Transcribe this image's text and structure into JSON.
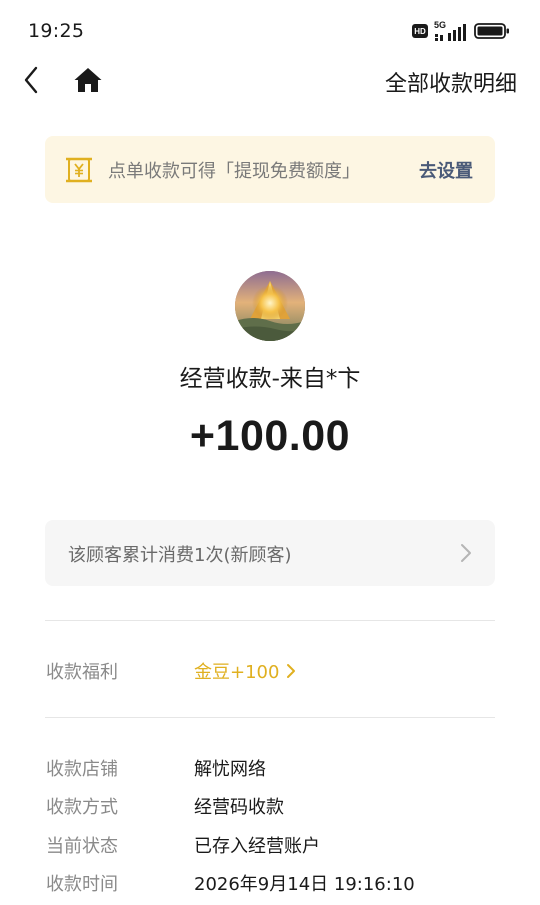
{
  "status_bar": {
    "time": "19:25",
    "hd": "HD",
    "network": "5G",
    "icons": [
      "hd-icon",
      "signal-5g-icon",
      "battery-icon"
    ]
  },
  "nav": {
    "title_link": "全部收款明细",
    "icons": [
      "back-arrow-icon",
      "home-icon"
    ]
  },
  "banner": {
    "text": "点单收款可得「提现免费额度」",
    "action": "去设置",
    "icon": "yuan-note-icon"
  },
  "payer": {
    "avatar": "avatar-image",
    "name": "经营收款-来自*卞",
    "amount": "+100.00"
  },
  "customer": {
    "text": "该顾客累计消费1次(新顾客)",
    "icon": "chevron-right-icon"
  },
  "benefit": {
    "label": "收款福利",
    "value": "金豆+100",
    "icon": "chevron-right-icon"
  },
  "details": [
    {
      "label": "收款店铺",
      "value": "解忧网络"
    },
    {
      "label": "收款方式",
      "value": "经营码收款"
    },
    {
      "label": "当前状态",
      "value": "已存入经营账户"
    },
    {
      "label": "收款时间",
      "value": "2026年9月14日 19:16:10"
    }
  ],
  "colors": {
    "banner_bg": "#fdf6e3",
    "banner_action": "#4a5a78",
    "accent_gold": "#e0b020",
    "card_bg": "#f6f6f6"
  }
}
